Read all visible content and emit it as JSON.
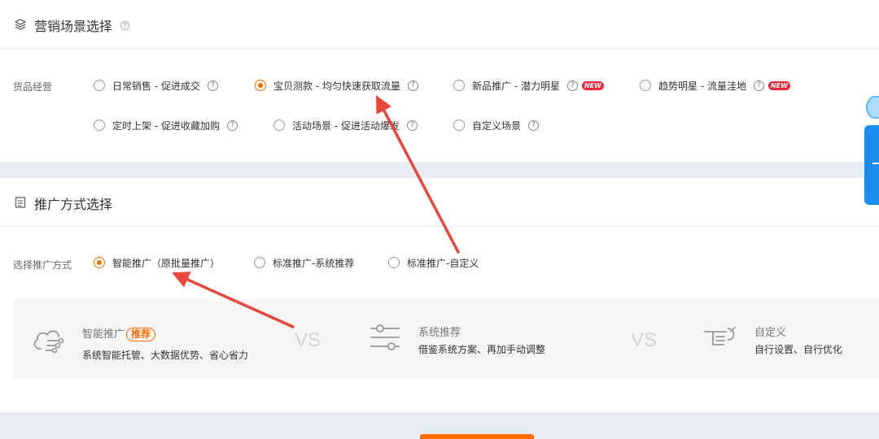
{
  "scene_section": {
    "title": "营销场景选择",
    "help": "?",
    "row_label": "货品经营",
    "options": [
      {
        "label": "日常销售 - 促进成交",
        "checked": false,
        "help": "?",
        "badge": ""
      },
      {
        "label": "宝贝测款 - 均匀快速获取流量",
        "checked": true,
        "help": "?",
        "badge": ""
      },
      {
        "label": "新品推广 - 潜力明星",
        "checked": false,
        "help": "?",
        "badge": "NEW"
      },
      {
        "label": "趋势明星 - 流量洼地",
        "checked": false,
        "help": "?",
        "badge": "NEW"
      },
      {
        "label": "定时上架 - 促进收藏加购",
        "checked": false,
        "help": "?",
        "badge": ""
      },
      {
        "label": "活动场景 - 促进活动爆发",
        "checked": false,
        "help": "?",
        "badge": ""
      },
      {
        "label": "自定义场景",
        "checked": false,
        "help": "?",
        "badge": ""
      }
    ]
  },
  "method_section": {
    "title": "推广方式选择",
    "row_label": "选择推广方式",
    "options": [
      {
        "label": "智能推广（原批量推广）",
        "checked": true
      },
      {
        "label": "标准推广-系统推荐",
        "checked": false
      },
      {
        "label": "标准推广-自定义",
        "checked": false
      }
    ],
    "compare": {
      "vs": "VS",
      "smart": {
        "title": "智能推广",
        "badge": "推荐",
        "desc": "系统智能托管、大数据优势、省心省力"
      },
      "system": {
        "title": "系统推荐",
        "desc": "借鉴系统方案、再加手动调整"
      },
      "custom": {
        "title": "自定义",
        "desc": "自行设置、自行优化"
      }
    }
  },
  "colors": {
    "accent": "#ff6c00",
    "arrow": "#e8463a",
    "badge_new": "#e8263c",
    "widget": "#1b8cf0"
  }
}
